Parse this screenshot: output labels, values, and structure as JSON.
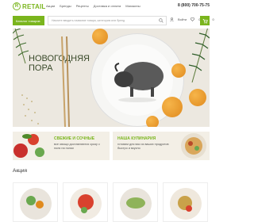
{
  "header": {
    "logo_text": "RETAIL",
    "logo_mark": "R",
    "nav": [
      "Акции",
      "Бренды",
      "Рецепты",
      "Доставка и оплата",
      "Магазины"
    ],
    "phone": "8 (800) 700-75-75"
  },
  "toolbar": {
    "catalog_label": "Каталог товаров",
    "search_placeholder": "Начните вводить название товара, категорию или бренд",
    "login_label": "Войти",
    "favorites_count": "0",
    "compare_count": "0"
  },
  "banner": {
    "title_line1": "НОВОГОДНЯЯ",
    "title_line2": "ПОРА"
  },
  "promos": [
    {
      "title": "СВЕЖИЕ И СОЧНЫЕ",
      "text": "все овощи доставляются сразу с поля на полки"
    },
    {
      "title": "НАША КУЛИНАРИЯ",
      "text": "готовим для вас из ваших продуктов быстро и вкусно"
    }
  ],
  "section": {
    "title": "Акция"
  },
  "colors": {
    "accent": "#7ab51d",
    "banner_bg": "#ece8e0",
    "orange": "#e08a1e"
  }
}
